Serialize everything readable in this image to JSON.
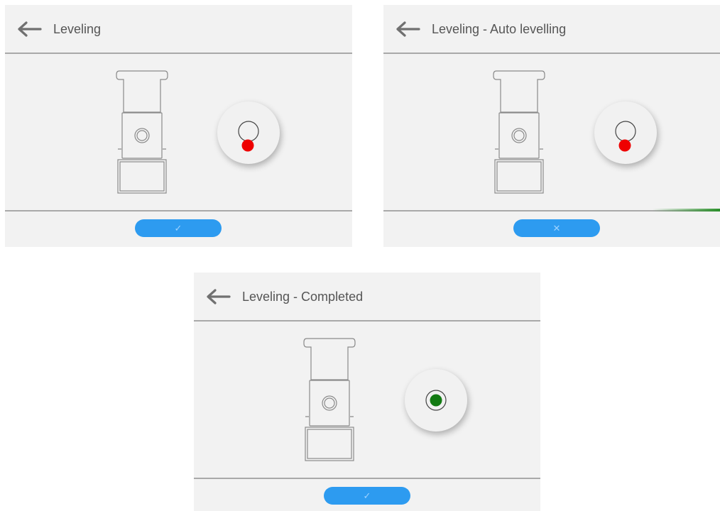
{
  "screens": [
    {
      "title": "Leveling",
      "bubble_status": "off-level",
      "bubble_color": "#ee0000",
      "button": {
        "icon": "checkmark-icon",
        "glyph": "✓"
      }
    },
    {
      "title": "Leveling - Auto levelling",
      "bubble_status": "off-level",
      "bubble_color": "#ee0000",
      "button": {
        "icon": "close-icon",
        "glyph": "✕"
      },
      "progress_indicator": true
    },
    {
      "title": "Leveling - Completed",
      "bubble_status": "level",
      "bubble_color": "#127a12",
      "button": {
        "icon": "checkmark-icon",
        "glyph": "✓"
      }
    }
  ],
  "colors": {
    "background": "#f2f2f2",
    "divider": "#a9a9a9",
    "button": "#2d9bf0",
    "title_text": "#555555"
  },
  "icons": {
    "back": "arrow-left-icon",
    "scale": "balance-scale-icon"
  }
}
